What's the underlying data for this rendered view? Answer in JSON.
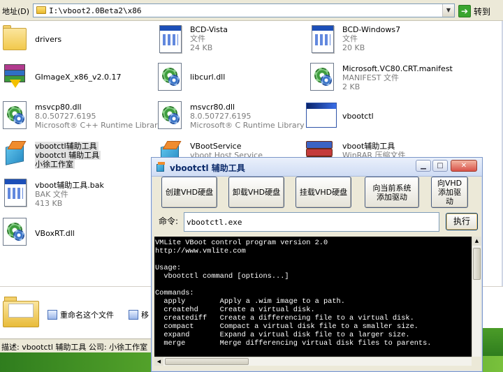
{
  "address_bar": {
    "label": "地址(D)",
    "path": "I:\\vboot2.0Beta2\\x86",
    "go_label": "转到",
    "go_icon": "arrow-right-icon"
  },
  "files": [
    {
      "name": "drivers",
      "lines": [],
      "icon": "folder-icon"
    },
    {
      "name": "BCD-Vista",
      "lines": [
        "文件",
        "24 KB"
      ],
      "icon": "document-icon"
    },
    {
      "name": "BCD-Windows7",
      "lines": [
        "文件",
        "20 KB"
      ],
      "icon": "document-icon"
    },
    {
      "name": "GImageX_x86_v2.0.17",
      "lines": [],
      "icon": "archive-installer-icon"
    },
    {
      "name": "libcurl.dll",
      "lines": [],
      "icon": "dll-gear-icon"
    },
    {
      "name": "Microsoft.VC80.CRT.manifest",
      "lines": [
        "MANIFEST 文件",
        "2 KB"
      ],
      "icon": "dll-gear-icon"
    },
    {
      "name": "msvcp80.dll",
      "lines": [
        "8.0.50727.6195",
        "Microsoft® C++ Runtime Library"
      ],
      "icon": "dll-gear-icon"
    },
    {
      "name": "msvcr80.dll",
      "lines": [
        "8.0.50727.6195",
        "Microsoft® C Runtime Library"
      ],
      "icon": "dll-gear-icon"
    },
    {
      "name": "vbootctl",
      "lines": [],
      "icon": "application-window-icon"
    },
    {
      "name": "vbootctl辅助工具",
      "lines": [
        "vbootctl 辅助工具",
        "小徐工作室"
      ],
      "icon": "cube-icon",
      "selected": true
    },
    {
      "name": "VBootService",
      "lines": [
        "vboot Host Service"
      ],
      "icon": "cube-icon"
    },
    {
      "name": "vboot辅助工具",
      "lines": [
        "WinRAR 压缩文件"
      ],
      "icon": "winrar-icon"
    },
    {
      "name": "vboot辅助工具.bak",
      "lines": [
        "BAK 文件",
        "413 KB"
      ],
      "icon": "document-icon"
    },
    {
      "name": "VBoxRT.dll",
      "lines": [],
      "icon": "dll-gear-icon"
    }
  ],
  "tasks": [
    {
      "label": "重命名这个文件",
      "icon": "rename-icon"
    },
    {
      "label": "移",
      "icon": "move-icon"
    }
  ],
  "status": {
    "text": "描述: vbootctl 辅助工具 公司: 小徐工作室"
  },
  "dialog": {
    "title": "vbootctl 辅助工具",
    "buttons": [
      {
        "label": "创建VHD硬盘"
      },
      {
        "label": "卸载VHD硬盘"
      },
      {
        "label": "挂载VHD硬盘"
      },
      {
        "label": "向当前系统添加驱动"
      },
      {
        "label": "向VHD添加驱动"
      }
    ],
    "command_label": "命令:",
    "command_value": "vbootctl.exe",
    "execute_label": "执行",
    "console_lines": [
      "VMLite VBoot control program version 2.0",
      "http://www.vmlite.com",
      "",
      "Usage:",
      "  vbootctl command [options...]",
      "",
      "Commands:",
      "  apply        Apply a .wim image to a path.",
      "  createhd     Create a virtual disk.",
      "  creatediff   Create a differencing file to a virtual disk.",
      "  compact      Compact a virtual disk file to a smaller size.",
      "  expand       Expand a virtual disk file to a larger size.",
      "  merge        Merge differencing virtual disk files to parents."
    ]
  }
}
